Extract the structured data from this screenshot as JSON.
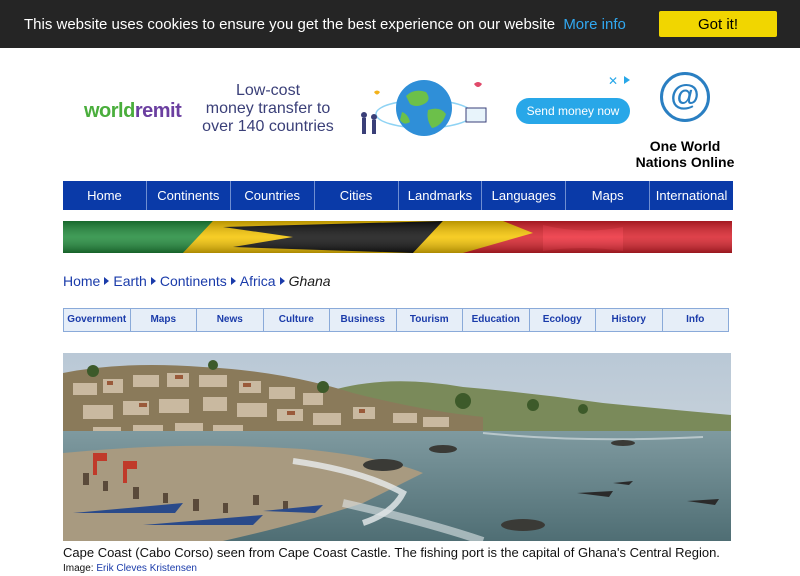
{
  "cookie": {
    "message": "This website uses cookies to ensure you get the best experience on our website",
    "more_info": "More info",
    "button": "Got it!"
  },
  "ad": {
    "brand_left": "world",
    "brand_right": "remit",
    "line1": "Low-cost",
    "line2": "money transfer to",
    "line3": "over 140 countries",
    "cta": "Send money now",
    "close": "✕"
  },
  "brand": {
    "logo_glyph": "@",
    "name_line1": "One World",
    "name_line2": "Nations Online"
  },
  "main_nav": [
    "Home",
    "Continents",
    "Countries",
    "Cities",
    "Landmarks",
    "Languages",
    "Maps",
    "International"
  ],
  "breadcrumb": {
    "items": [
      "Home",
      "Earth",
      "Continents",
      "Africa"
    ],
    "current": "Ghana"
  },
  "sub_nav": [
    "Government",
    "Maps",
    "News",
    "Culture",
    "Business",
    "Tourism",
    "Education",
    "Ecology",
    "History",
    "Info"
  ],
  "photo": {
    "caption": "Cape Coast (Cabo Corso) seen from Cape Coast Castle. The fishing port is the capital of Ghana's Central Region.",
    "credit_label": "Image:",
    "credit_name": "Erik Cleves Kristensen"
  },
  "colors": {
    "nav_bg": "#0a3aa8",
    "cookie_bg": "#252525",
    "cookie_button": "#f1d600",
    "flag_green": "#1f8a3a",
    "flag_yellow": "#f5c400",
    "flag_red": "#d8202a",
    "flag_black": "#111111"
  }
}
